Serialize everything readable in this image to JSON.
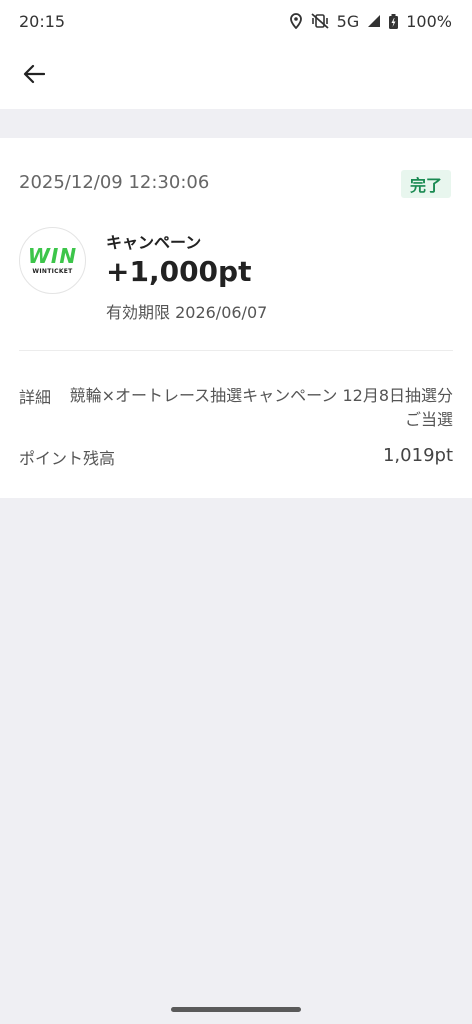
{
  "status_bar": {
    "time": "20:15",
    "network": "5G",
    "battery": "100%",
    "icons": [
      "location-icon",
      "vibrate-off-icon",
      "signal-icon",
      "battery-icon"
    ]
  },
  "app_bar": {
    "back_icon": "arrow-left-icon"
  },
  "transaction": {
    "datetime": "2025/12/09 12:30:06",
    "status": "完了",
    "logo_text": "WIN",
    "logo_subtext": "WINTICKET",
    "title": "キャンペーン",
    "amount": "+1,000pt",
    "expiry": "有効期限 2026/06/07",
    "detail_label": "詳細",
    "detail_value": "競輪×オートレース抽選キャンペーン 12月8日抽選分ご当選",
    "balance_label": "ポイント残高",
    "balance_value": "1,019pt"
  },
  "colors": {
    "accent_green": "#1a8a52",
    "badge_bg": "#e8f6ee",
    "logo_green": "#3cc54a",
    "page_bg": "#efeff3"
  }
}
